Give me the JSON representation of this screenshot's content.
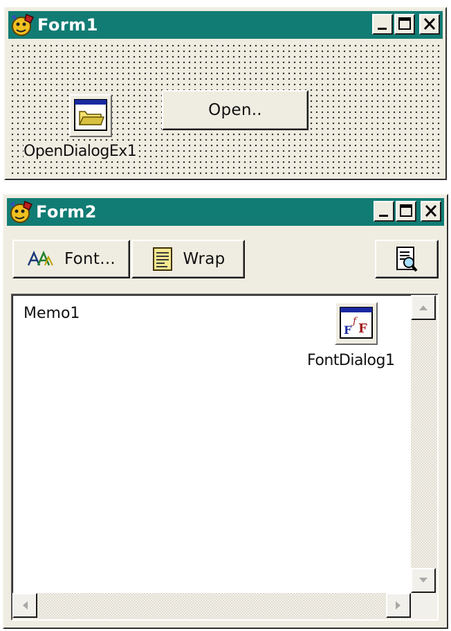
{
  "form1": {
    "title": "Form1",
    "open_button_label": "Open..",
    "component_caption": "OpenDialogEx1",
    "component_icon": "open-folder-icon"
  },
  "form2": {
    "title": "Form2",
    "toolbar": {
      "font_button_label": "Font...",
      "wrap_button_label": "Wrap",
      "preview_icon": "print-preview-icon"
    },
    "memo": {
      "text": "Memo1"
    },
    "component_caption": "FontDialog1",
    "component_icon": "font-dialog-icon"
  },
  "colors": {
    "titlebar": "#117c74",
    "face": "#efece1"
  }
}
